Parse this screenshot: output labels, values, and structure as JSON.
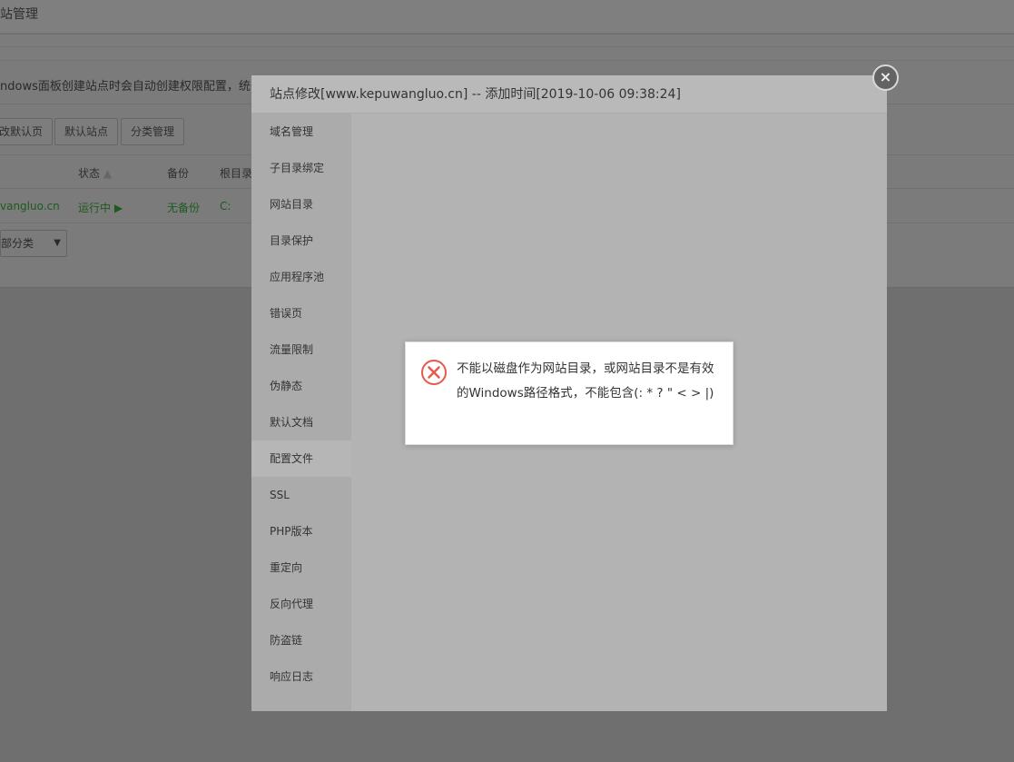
{
  "page": {
    "title": "站管理",
    "notice": "ndows面板创建站点时会自动创建权限配置，统一使用",
    "buttons": [
      "改默认页",
      "默认站点",
      "分类管理"
    ],
    "table": {
      "headers": [
        "状态",
        "备份",
        "根目录"
      ],
      "row": {
        "site": "vangluo.cn",
        "status": "运行中 ▶",
        "backup": "无备份",
        "root": "C:"
      }
    },
    "category_select": "部分类"
  },
  "modal": {
    "title": "站点修改[www.kepuwangluo.cn] -- 添加时间[2019-10-06 09:38:24]",
    "menu": [
      "域名管理",
      "子目录绑定",
      "网站目录",
      "目录保护",
      "应用程序池",
      "错误页",
      "流量限制",
      "伪静态",
      "默认文档",
      "配置文件",
      "SSL",
      "PHP版本",
      "重定向",
      "反向代理",
      "防盗链",
      "响应日志"
    ],
    "active_index": 9,
    "close": "×"
  },
  "alert": {
    "icon": "error-icon",
    "message": "不能以磁盘作为网站目录，或网站目录不是有效的Windows路径格式，不能包含(: * ? \" < > |)"
  }
}
